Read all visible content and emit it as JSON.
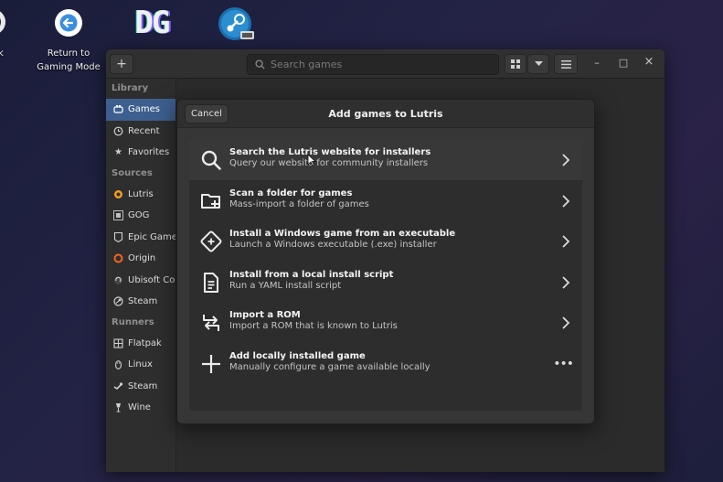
{
  "desktop": {
    "partial_label": "k",
    "return_label_1": "Return to",
    "return_label_2": "Gaming Mode",
    "dg_logo": "DG"
  },
  "window": {
    "search_placeholder": "Search games",
    "add_button": "+",
    "minimize": "–",
    "maximize": "□",
    "close": "×"
  },
  "sidebar": {
    "library_header": "Library",
    "library_items": [
      {
        "label": "Games",
        "icon": "gamepad-icon"
      },
      {
        "label": "Recent",
        "icon": "clock-icon"
      },
      {
        "label": "Favorites",
        "icon": "star-icon"
      }
    ],
    "sources_header": "Sources",
    "sources_items": [
      {
        "label": "Lutris",
        "icon": "lutris-icon"
      },
      {
        "label": "GOG",
        "icon": "gog-icon"
      },
      {
        "label": "Epic Games",
        "icon": "epic-icon"
      },
      {
        "label": "Origin",
        "icon": "origin-icon"
      },
      {
        "label": "Ubisoft Con",
        "icon": "ubisoft-icon"
      },
      {
        "label": "Steam",
        "icon": "steam-icon"
      }
    ],
    "runners_header": "Runners",
    "runners_items": [
      {
        "label": "Flatpak",
        "icon": "flatpak-icon"
      },
      {
        "label": "Linux",
        "icon": "linux-icon"
      },
      {
        "label": "Steam",
        "icon": "steam-icon"
      },
      {
        "label": "Wine",
        "icon": "wine-icon"
      }
    ]
  },
  "dialog": {
    "title": "Add games to Lutris",
    "cancel_label": "Cancel",
    "options": [
      {
        "title": "Search the Lutris website for installers",
        "subtitle": "Query our website for community installers",
        "icon": "search-icon"
      },
      {
        "title": "Scan a folder for games",
        "subtitle": "Mass-import a folder of games",
        "icon": "folder-add-icon"
      },
      {
        "title": "Install a Windows game from an executable",
        "subtitle": "Launch a Windows executable (.exe) installer",
        "icon": "windows-exe-icon"
      },
      {
        "title": "Install from a local install script",
        "subtitle": "Run a YAML install script",
        "icon": "script-icon"
      },
      {
        "title": "Import a ROM",
        "subtitle": "Import a ROM that is known to Lutris",
        "icon": "rom-import-icon"
      },
      {
        "title": "Add locally installed game",
        "subtitle": "Manually configure a game available locally",
        "icon": "plus-icon"
      }
    ]
  },
  "colors": {
    "accent": "#3d5f8f",
    "desktop_bg": "#1f2140",
    "window_bg": "#2b2b2b",
    "dialog_bg": "#363636"
  }
}
